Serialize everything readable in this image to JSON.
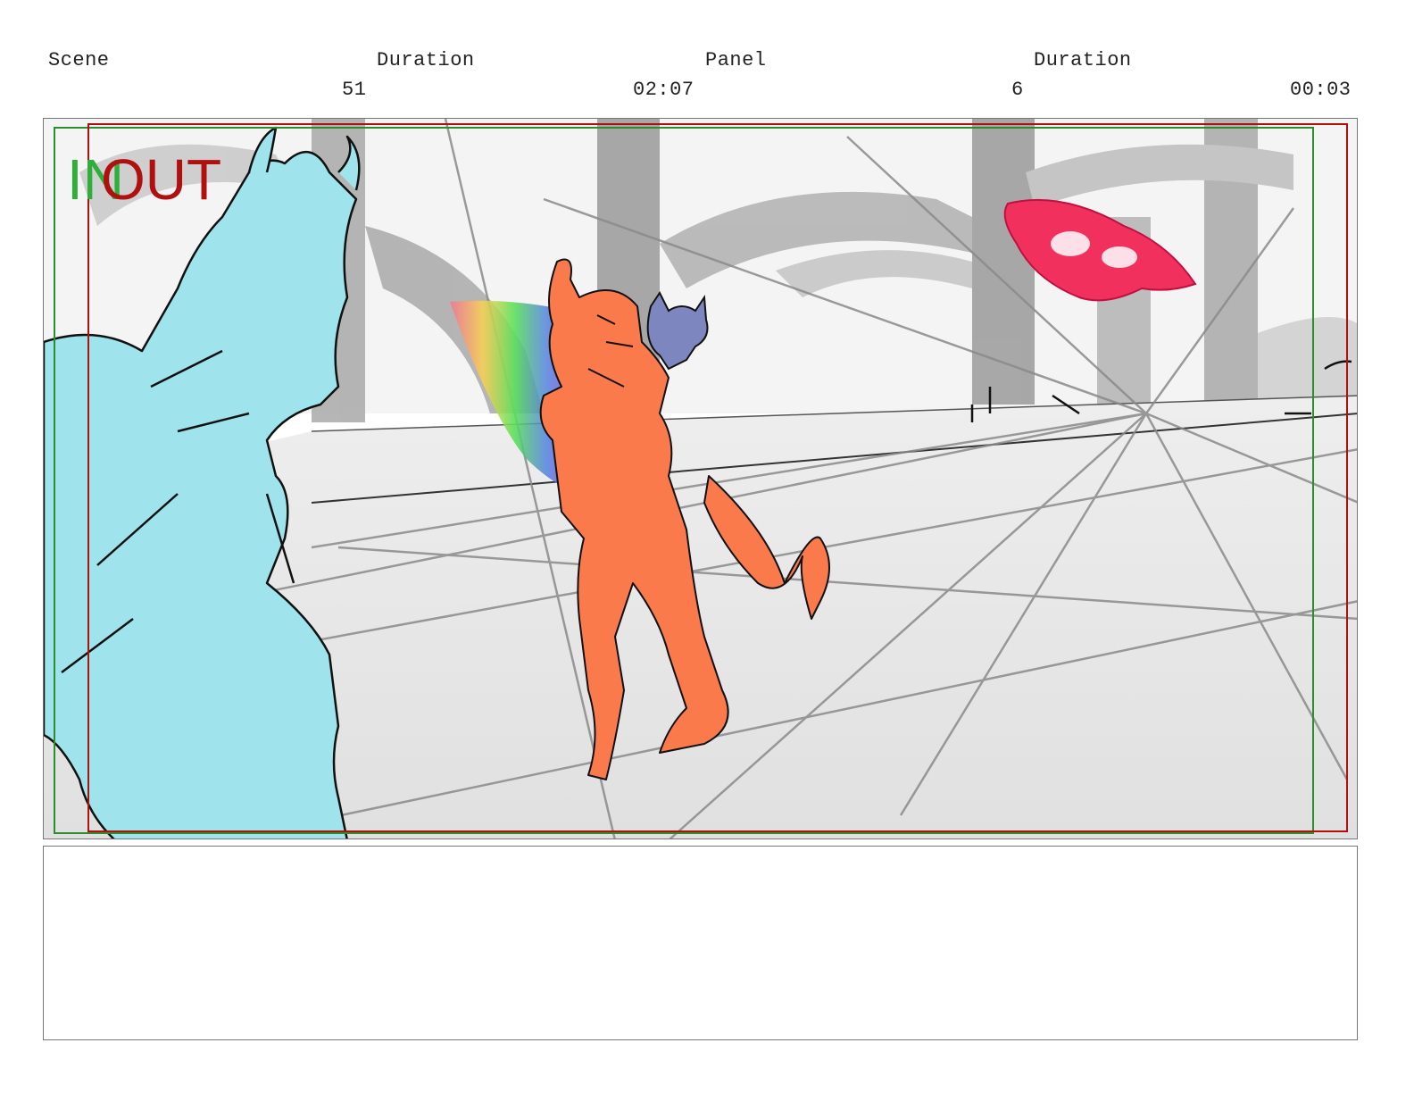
{
  "header": {
    "scene_label": "Scene",
    "scene_duration_label": "Duration",
    "panel_label": "Panel",
    "panel_duration_label": "Duration",
    "scene_number": "51",
    "scene_duration": "02:07",
    "panel_number": "6",
    "panel_duration": "00:03"
  },
  "frame": {
    "in_marker": "IN",
    "out_marker": "OUT",
    "safe_area_green": "#2e8b2e",
    "safe_area_red": "#b01010",
    "characters": {
      "left_character_color": "#9fe3ec",
      "center_character_color": "#fb7a4c",
      "cat_color": "#7d86bf",
      "floating_creature_color": "#f2305e"
    }
  },
  "notes": {
    "text": ""
  }
}
